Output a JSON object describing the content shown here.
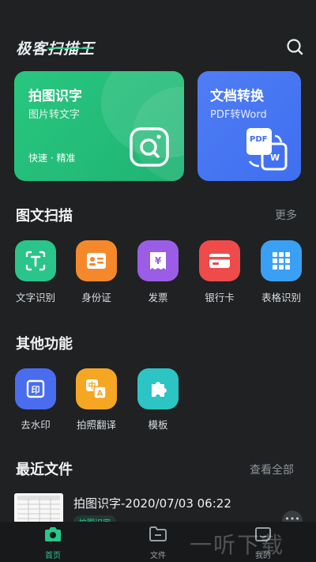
{
  "header": {
    "app_title": "极客扫描王",
    "search_icon": "search-icon"
  },
  "cards": {
    "ocr": {
      "title": "拍图识字",
      "subtitle": "图片转文字",
      "tags": "快速 · 精准",
      "icon": "scan-icon"
    },
    "doc": {
      "title": "文档转换",
      "subtitle": "PDF转Word",
      "icon": "pdf-word-icon",
      "pdf_label": "PDF",
      "word_label": "W"
    }
  },
  "scan_section": {
    "title": "图文扫描",
    "more": "更多",
    "tools": [
      {
        "label": "文字识别",
        "icon": "text-recognition-icon",
        "color": "#2bc48a"
      },
      {
        "label": "身份证",
        "icon": "id-card-icon",
        "color": "#f5882a"
      },
      {
        "label": "发票",
        "icon": "invoice-icon",
        "color": "#9b5de5"
      },
      {
        "label": "银行卡",
        "icon": "bank-card-icon",
        "color": "#ef4b4b"
      },
      {
        "label": "表格识别",
        "icon": "table-icon",
        "color": "#3aa0f5"
      }
    ]
  },
  "other_section": {
    "title": "其他功能",
    "tools": [
      {
        "label": "去水印",
        "icon": "remove-watermark-icon",
        "color": "#4a6df0"
      },
      {
        "label": "拍照翻译",
        "icon": "translate-icon",
        "color": "#f5a623"
      },
      {
        "label": "模板",
        "icon": "puzzle-icon",
        "color": "#2dc4c4"
      }
    ]
  },
  "recent": {
    "title": "最近文件",
    "view_all": "查看全部",
    "file_name": "拍图识字-2020/07/03 06:22",
    "file_badge": "拍图识字",
    "more": "•••"
  },
  "bottom_nav": {
    "items": [
      {
        "label": "首页",
        "icon": "camera-icon",
        "active": true
      },
      {
        "label": "文件",
        "icon": "folder-icon",
        "active": false
      },
      {
        "label": "我的",
        "icon": "user-icon",
        "active": false
      }
    ]
  },
  "watermark": "一听下载",
  "colors": {
    "background": "#1f2123",
    "accent_green": "#27c98a",
    "card_green": "#28c77f",
    "card_blue": "#4f7df5"
  }
}
